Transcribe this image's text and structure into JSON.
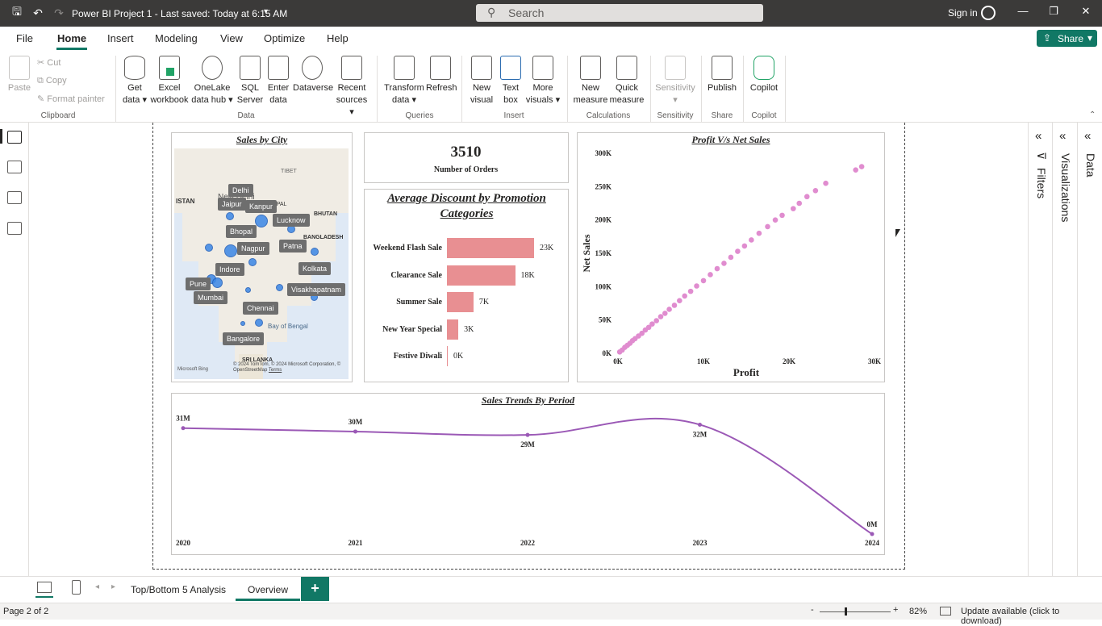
{
  "titlebar": {
    "title": "Power BI Project 1  -  Last saved: Today at 6:15 AM",
    "search_placeholder": "Search",
    "sign_in": "Sign in"
  },
  "menu": {
    "items": [
      "File",
      "Home",
      "Insert",
      "Modeling",
      "View",
      "Optimize",
      "Help"
    ],
    "active": "Home",
    "share": "Share"
  },
  "ribbon": {
    "clipboard": {
      "paste": "Paste",
      "cut": "Cut",
      "copy": "Copy",
      "format_painter": "Format painter",
      "group": "Clipboard"
    },
    "data": {
      "get_data": [
        "Get",
        "data"
      ],
      "excel": [
        "Excel",
        "workbook"
      ],
      "onelake": [
        "OneLake",
        "data hub"
      ],
      "sql": [
        "SQL",
        "Server"
      ],
      "enter": [
        "Enter",
        "data"
      ],
      "dataverse": [
        "Dataverse"
      ],
      "recent": [
        "Recent",
        "sources"
      ],
      "group": "Data"
    },
    "queries": {
      "transform": [
        "Transform",
        "data"
      ],
      "refresh": [
        "Refresh"
      ],
      "group": "Queries"
    },
    "insert": {
      "new_visual": [
        "New",
        "visual"
      ],
      "text_box": [
        "Text",
        "box"
      ],
      "more_visuals": [
        "More",
        "visuals"
      ],
      "group": "Insert"
    },
    "calculations": {
      "new_measure": [
        "New",
        "measure"
      ],
      "quick_measure": [
        "Quick",
        "measure"
      ],
      "group": "Calculations"
    },
    "sensitivity": {
      "label": [
        "Sensitivity"
      ],
      "group": "Sensitivity"
    },
    "share": {
      "publish": [
        "Publish"
      ],
      "group": "Share"
    },
    "copilot": {
      "label": [
        "Copilot"
      ],
      "group": "Copilot"
    }
  },
  "report": {
    "sales_by_city": {
      "title": "Sales by City",
      "cities": [
        "Delhi",
        "New Delhi",
        "Jaipur",
        "Kanpur",
        "Lucknow",
        "Bhopal",
        "Patna",
        "Nagpur",
        "Indore",
        "Kolkata",
        "Pune",
        "Mumbai",
        "Visakhapatnam",
        "Chennai",
        "Bangalore"
      ],
      "map_labels": [
        "TIBET",
        "ISTAN",
        "NEPAL",
        "BHUTAN",
        "BANGLADESH",
        "Bay of Bengal",
        "SRI LANKA"
      ],
      "copyright": "© 2024 TomTom, © 2024 Microsoft Corporation, © OpenStreetMap",
      "terms": "Terms",
      "bing": "Microsoft Bing"
    },
    "kpi": {
      "value": "3510",
      "label": "Number of Orders"
    },
    "discount": {
      "title": "Average Discount by Promotion Categories"
    },
    "profit_vs_sales": {
      "title": "Profit V/s Net Sales"
    },
    "trend": {
      "title": "Sales Trends By Period"
    }
  },
  "chart_data": [
    {
      "type": "bar",
      "title": "Average Discount by Promotion Categories",
      "categories": [
        "Weekend Flash Sale",
        "Clearance Sale",
        "Summer Sale",
        "New Year Special",
        "Festive Diwali"
      ],
      "values": [
        23,
        18,
        7,
        3,
        0
      ],
      "value_labels": [
        "23K",
        "18K",
        "7K",
        "3K",
        "0K"
      ]
    },
    {
      "type": "scatter",
      "title": "Profit V/s Net Sales",
      "xlabel": "Profit",
      "ylabel": "Net Sales",
      "x_ticks": [
        "0K",
        "10K",
        "20K",
        "30K"
      ],
      "y_ticks": [
        "0K",
        "50K",
        "100K",
        "150K",
        "200K",
        "250K",
        "300K"
      ],
      "xlim": [
        0,
        30
      ],
      "ylim": [
        0,
        300
      ],
      "points": [
        [
          0.2,
          2
        ],
        [
          0.5,
          5
        ],
        [
          0.8,
          9
        ],
        [
          1.1,
          12
        ],
        [
          1.4,
          15
        ],
        [
          1.7,
          19
        ],
        [
          2.0,
          22
        ],
        [
          2.4,
          26
        ],
        [
          2.8,
          30
        ],
        [
          3.2,
          35
        ],
        [
          3.6,
          39
        ],
        [
          4.0,
          44
        ],
        [
          4.5,
          49
        ],
        [
          5.0,
          55
        ],
        [
          5.5,
          60
        ],
        [
          6.0,
          66
        ],
        [
          6.6,
          72
        ],
        [
          7.2,
          79
        ],
        [
          7.8,
          86
        ],
        [
          8.5,
          93
        ],
        [
          9.2,
          101
        ],
        [
          10.0,
          109
        ],
        [
          10.8,
          118
        ],
        [
          11.6,
          127
        ],
        [
          12.4,
          135
        ],
        [
          13.2,
          144
        ],
        [
          14.0,
          153
        ],
        [
          14.8,
          161
        ],
        [
          15.6,
          170
        ],
        [
          16.5,
          180
        ],
        [
          17.5,
          190
        ],
        [
          18.4,
          200
        ],
        [
          19.2,
          207
        ],
        [
          20.5,
          217
        ],
        [
          21.2,
          225
        ],
        [
          22.1,
          235
        ],
        [
          23.1,
          244
        ],
        [
          24.3,
          255
        ],
        [
          27.8,
          275
        ],
        [
          28.5,
          280
        ]
      ],
      "point_color": "#e08ccf"
    },
    {
      "type": "line",
      "title": "Sales Trends By Period",
      "x": [
        "2020",
        "2021",
        "2022",
        "2023",
        "2024"
      ],
      "values": [
        31,
        30,
        29,
        32,
        0
      ],
      "value_labels": [
        "31M",
        "30M",
        "29M",
        "32M",
        "0M"
      ],
      "line_color": "#9b59b6",
      "ylim": [
        0,
        34
      ]
    }
  ],
  "panes": {
    "filters": "Filters",
    "visualizations": "Visualizations",
    "data": "Data"
  },
  "tabs": {
    "items": [
      "Top/Bottom 5 Analysis",
      "Overview"
    ],
    "active": "Overview",
    "add": "+"
  },
  "status": {
    "page": "Page 2 of 2",
    "zoom": "82%",
    "update": "Update available (click to download)"
  }
}
